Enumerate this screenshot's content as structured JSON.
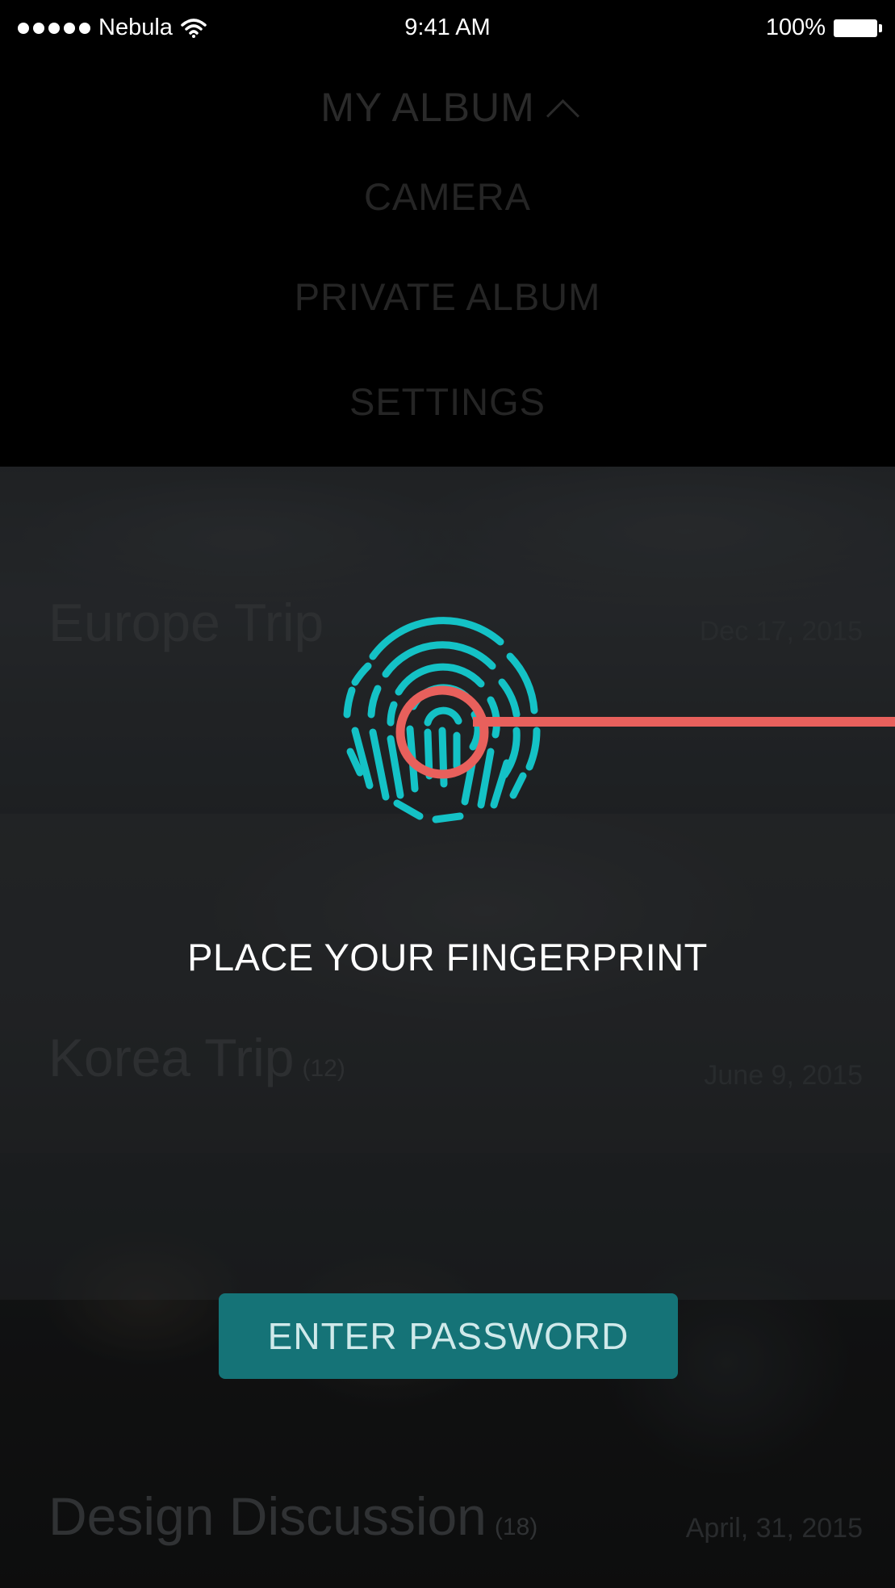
{
  "status_bar": {
    "carrier": "Nebula",
    "time": "9:41 AM",
    "battery": "100%"
  },
  "menu": {
    "title": "MY ALBUM",
    "items": [
      "CAMERA",
      "PRIVATE ALBUM",
      "SETTINGS"
    ]
  },
  "albums": [
    {
      "title": "Europe Trip",
      "count": "",
      "date": "Dec 17, 2015"
    },
    {
      "title": "Korea Trip",
      "count": "(12)",
      "date": "June 9, 2015"
    },
    {
      "title": "Design Discussion",
      "count": "(18)",
      "date": "April, 31, 2015"
    }
  ],
  "auth": {
    "prompt": "PLACE YOUR FINGERPRINT",
    "button_label": "ENTER PASSWORD"
  },
  "colors": {
    "fingerprint": "#14c2c6",
    "scan_ring": "#e8605c",
    "button": "#157377"
  }
}
